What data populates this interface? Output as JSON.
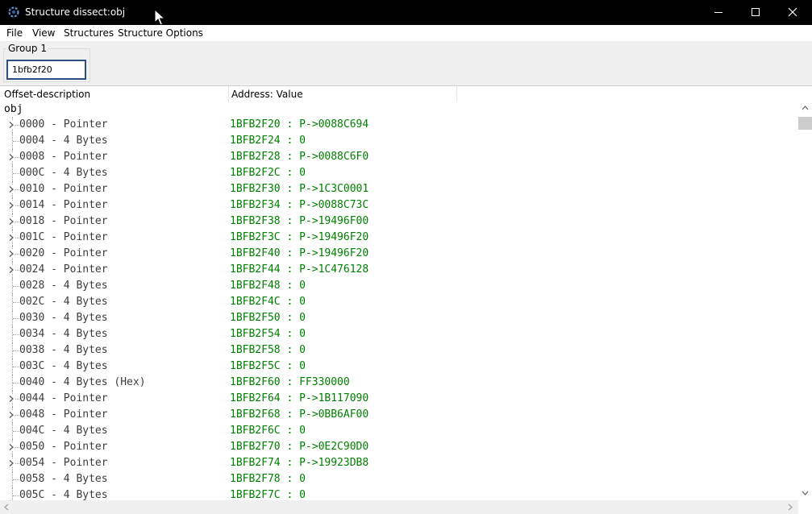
{
  "window": {
    "title": "Structure dissect:obj",
    "icon": "cheat-engine-gear-icon"
  },
  "menu": [
    "File",
    "View",
    "Structures",
    "Structure Options"
  ],
  "group": {
    "label": "Group 1",
    "address": "1bfb2f20"
  },
  "columns": {
    "offset": "Offset-description",
    "value": "Address: Value"
  },
  "root": "obj",
  "colors": {
    "value_text": "#008000",
    "offset_text": "#3c3c3c",
    "titlebar": "#000000"
  },
  "rows": [
    {
      "offset": "0000 - Pointer",
      "value": "1BFB2F20 : P->0088C694",
      "expandable": true
    },
    {
      "offset": "0004 - 4 Bytes",
      "value": "1BFB2F24 : 0",
      "expandable": false
    },
    {
      "offset": "0008 - Pointer",
      "value": "1BFB2F28 : P->0088C6F0",
      "expandable": true
    },
    {
      "offset": "000C - 4 Bytes",
      "value": "1BFB2F2C : 0",
      "expandable": false
    },
    {
      "offset": "0010 - Pointer",
      "value": "1BFB2F30 : P->1C3C0001",
      "expandable": true
    },
    {
      "offset": "0014 - Pointer",
      "value": "1BFB2F34 : P->0088C73C",
      "expandable": true
    },
    {
      "offset": "0018 - Pointer",
      "value": "1BFB2F38 : P->19496F00",
      "expandable": true
    },
    {
      "offset": "001C - Pointer",
      "value": "1BFB2F3C : P->19496F20",
      "expandable": true
    },
    {
      "offset": "0020 - Pointer",
      "value": "1BFB2F40 : P->19496F20",
      "expandable": true
    },
    {
      "offset": "0024 - Pointer",
      "value": "1BFB2F44 : P->1C476128",
      "expandable": true
    },
    {
      "offset": "0028 - 4 Bytes",
      "value": "1BFB2F48 : 0",
      "expandable": false
    },
    {
      "offset": "002C - 4 Bytes",
      "value": "1BFB2F4C : 0",
      "expandable": false
    },
    {
      "offset": "0030 - 4 Bytes",
      "value": "1BFB2F50 : 0",
      "expandable": false
    },
    {
      "offset": "0034 - 4 Bytes",
      "value": "1BFB2F54 : 0",
      "expandable": false
    },
    {
      "offset": "0038 - 4 Bytes",
      "value": "1BFB2F58 : 0",
      "expandable": false
    },
    {
      "offset": "003C - 4 Bytes",
      "value": "1BFB2F5C : 0",
      "expandable": false
    },
    {
      "offset": "0040 - 4 Bytes (Hex)",
      "value": "1BFB2F60 : FF330000",
      "expandable": false
    },
    {
      "offset": "0044 - Pointer",
      "value": "1BFB2F64 : P->1B117090",
      "expandable": true
    },
    {
      "offset": "0048 - Pointer",
      "value": "1BFB2F68 : P->0BB6AF00",
      "expandable": true
    },
    {
      "offset": "004C - 4 Bytes",
      "value": "1BFB2F6C : 0",
      "expandable": false
    },
    {
      "offset": "0050 - Pointer",
      "value": "1BFB2F70 : P->0E2C90D0",
      "expandable": true
    },
    {
      "offset": "0054 - Pointer",
      "value": "1BFB2F74 : P->19923DB8",
      "expandable": true
    },
    {
      "offset": "0058 - 4 Bytes",
      "value": "1BFB2F78 : 0",
      "expandable": false
    },
    {
      "offset": "005C - 4 Bytes",
      "value": "1BFB2F7C : 0",
      "expandable": false
    }
  ]
}
